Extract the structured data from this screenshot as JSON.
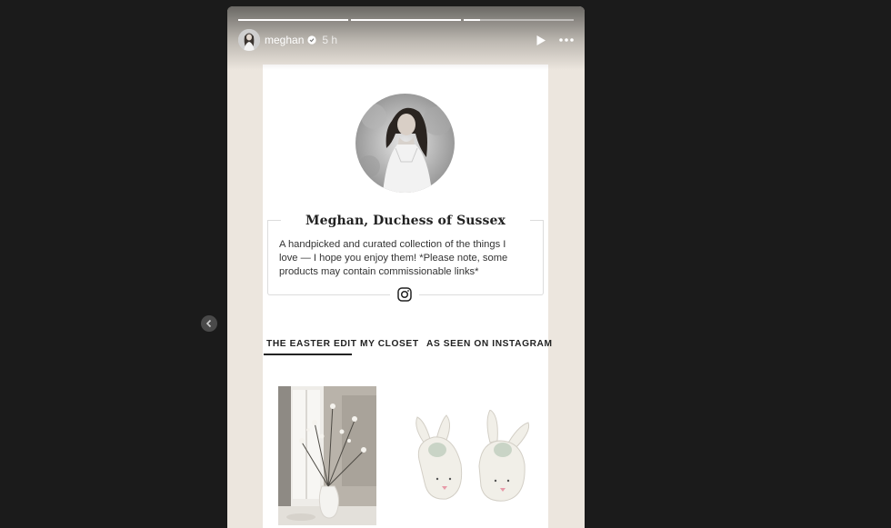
{
  "story": {
    "username": "meghan",
    "time": "5 h",
    "progress": [
      1.0,
      1.0,
      0.15
    ]
  },
  "profile": {
    "name": "Meghan, Duchess of Sussex",
    "bio": "A handpicked and curated collection of the things I love — I hope you enjoy them! *Please note, some products may contain commissionable links*"
  },
  "tabs": [
    {
      "label": "THE EASTER EDIT",
      "active": true
    },
    {
      "label": "MY CLOSET",
      "active": false
    },
    {
      "label": "AS SEEN ON INSTAGRAM",
      "active": false
    }
  ],
  "icons": {
    "prev": "chevron-left-icon",
    "verified": "verified-badge-icon",
    "play": "play-icon",
    "more": "more-icon",
    "instagram": "instagram-icon"
  },
  "colors": {
    "background": "#1b1b1b",
    "story_bg": "#ece6de",
    "accent": "#222222"
  }
}
